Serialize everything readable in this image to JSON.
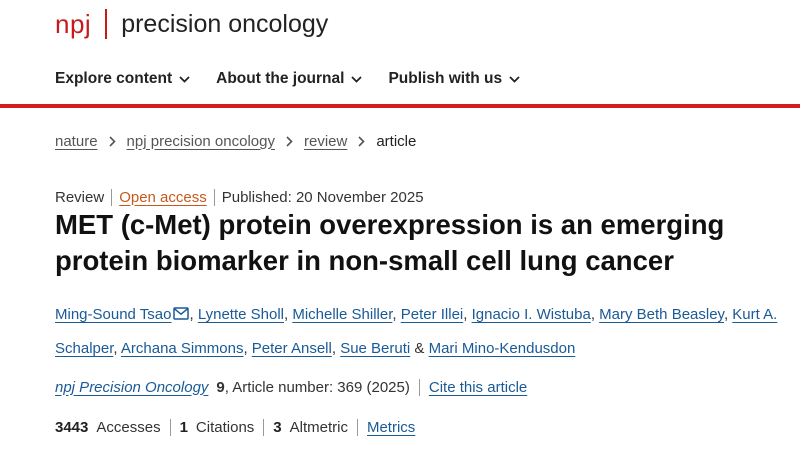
{
  "brand": {
    "short": "npj",
    "name": "precision oncology"
  },
  "nav": [
    {
      "label": "Explore content"
    },
    {
      "label": "About the journal"
    },
    {
      "label": "Publish with us"
    }
  ],
  "breadcrumb": [
    "nature",
    "npj precision oncology",
    "review",
    "article"
  ],
  "meta": {
    "type": "Review",
    "access": "Open access",
    "published": "Published: 20 November 2025"
  },
  "title": "MET (c-Met) protein overexpression is an emerging protein biomarker in non-small cell lung cancer",
  "authors": [
    "Ming-Sound Tsao",
    "Lynette Sholl",
    "Michelle Shiller",
    "Peter Illei",
    "Ignacio I. Wistuba",
    "Mary Beth Beasley",
    "Kurt A. Schalper",
    "Archana Simmons",
    "Peter Ansell",
    "Sue Beruti",
    "Mari Mino-Kendusdon"
  ],
  "journal": {
    "name": "npj Precision Oncology",
    "volume": "9",
    "article": ", Article number: 369 (2025)",
    "cite": "Cite this article"
  },
  "metrics": {
    "accesses_count": "3443",
    "accesses_label": "Accesses",
    "citations_count": "1",
    "citations_label": "Citations",
    "altmetric_count": "3",
    "altmetric_label": "Altmetric",
    "link": "Metrics"
  },
  "colors": {
    "brand_red": "#c71b1b",
    "link_blue": "#1a5a96",
    "open_access_orange": "#c75a1b"
  }
}
